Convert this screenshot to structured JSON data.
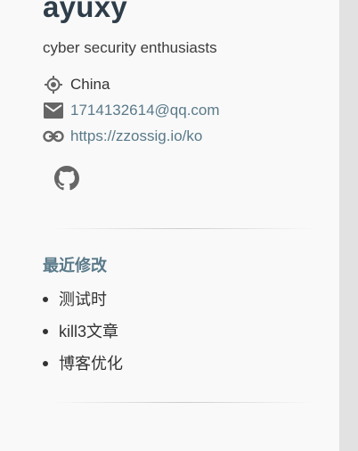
{
  "author": {
    "name": "ayuxy",
    "bio": "cyber security enthusiasts",
    "location": "China",
    "email": "1714132614@qq.com",
    "website": "https://zzossig.io/ko",
    "social_icon": "github-icon"
  },
  "recent": {
    "title": "最近修改",
    "items": [
      {
        "label": "测试时"
      },
      {
        "label": "kill3文章"
      },
      {
        "label": "博客优化"
      }
    ]
  },
  "colors": {
    "name": "#2e3d49",
    "link": "#5a7a8a",
    "icon": "#666666",
    "scrollbar": "#e2e2e2"
  }
}
